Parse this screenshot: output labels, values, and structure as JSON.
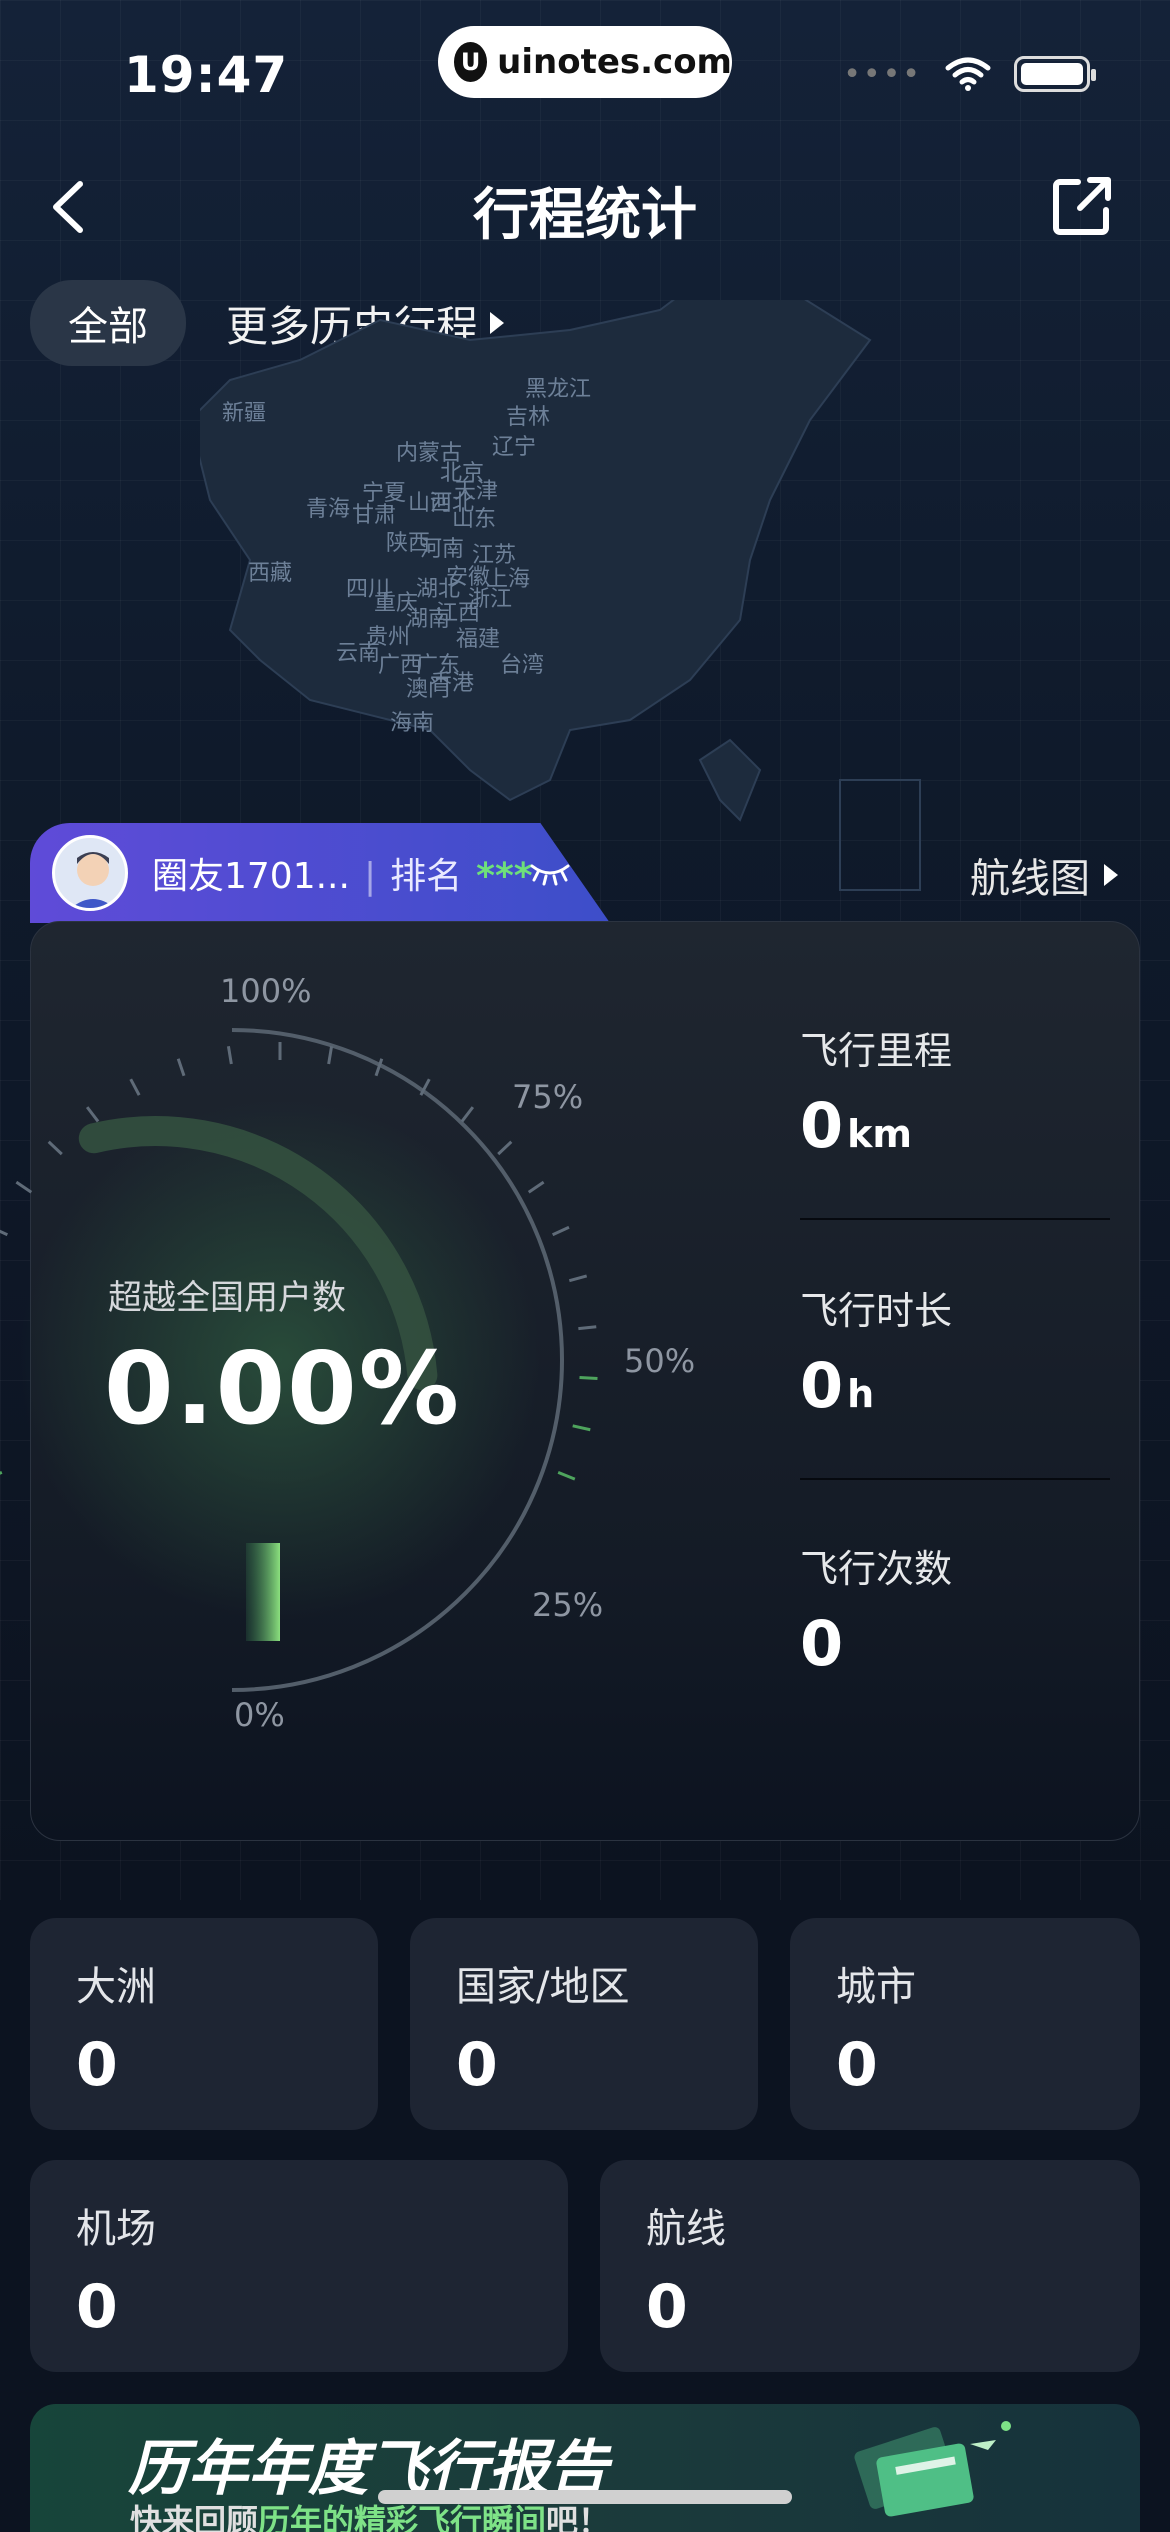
{
  "status": {
    "time": "19:47",
    "site": "uinotes.com"
  },
  "nav": {
    "title": "行程统计"
  },
  "filters": {
    "all_label": "全部",
    "more_label": "更多历史行程"
  },
  "map": {
    "provinces": [
      "新疆",
      "西藏",
      "青海",
      "甘肃",
      "宁夏",
      "内蒙古",
      "黑龙江",
      "吉林",
      "辽宁",
      "北京",
      "天津",
      "河北",
      "山西",
      "陕西",
      "山东",
      "河南",
      "江苏",
      "安徽",
      "上海",
      "湖北",
      "浙江",
      "四川",
      "重庆",
      "湖南",
      "江西",
      "福建",
      "贵州",
      "云南",
      "广西",
      "广东",
      "台湾",
      "香港",
      "澳门",
      "海南"
    ],
    "route_link": "航线图"
  },
  "user": {
    "name": "圈友1701...",
    "rank_label": "排名",
    "rank_value": "***"
  },
  "gauge": {
    "label": "超越全国用户数",
    "value": "0.00%",
    "percent": 0,
    "tick_labels": [
      "100%",
      "75%",
      "50%",
      "25%",
      "0%"
    ]
  },
  "metrics": [
    {
      "label": "飞行里程",
      "value": "0",
      "unit": "km"
    },
    {
      "label": "飞行时长",
      "value": "0",
      "unit": "h"
    },
    {
      "label": "飞行次数",
      "value": "0",
      "unit": ""
    }
  ],
  "tiles": [
    {
      "label": "大洲",
      "value": "0"
    },
    {
      "label": "国家/地区",
      "value": "0"
    },
    {
      "label": "城市",
      "value": "0"
    },
    {
      "label": "机场",
      "value": "0"
    },
    {
      "label": "航线",
      "value": "0"
    }
  ],
  "banner": {
    "title": "历年年度飞行报告",
    "sub_prefix": "快来回顾",
    "sub_highlight": "历年的精彩飞行瞬间",
    "sub_suffix": "吧！"
  },
  "colors": {
    "accent_green": "#6ee07a",
    "tab_purple": "#5f4bd8",
    "card_bg": "#1e2533"
  }
}
